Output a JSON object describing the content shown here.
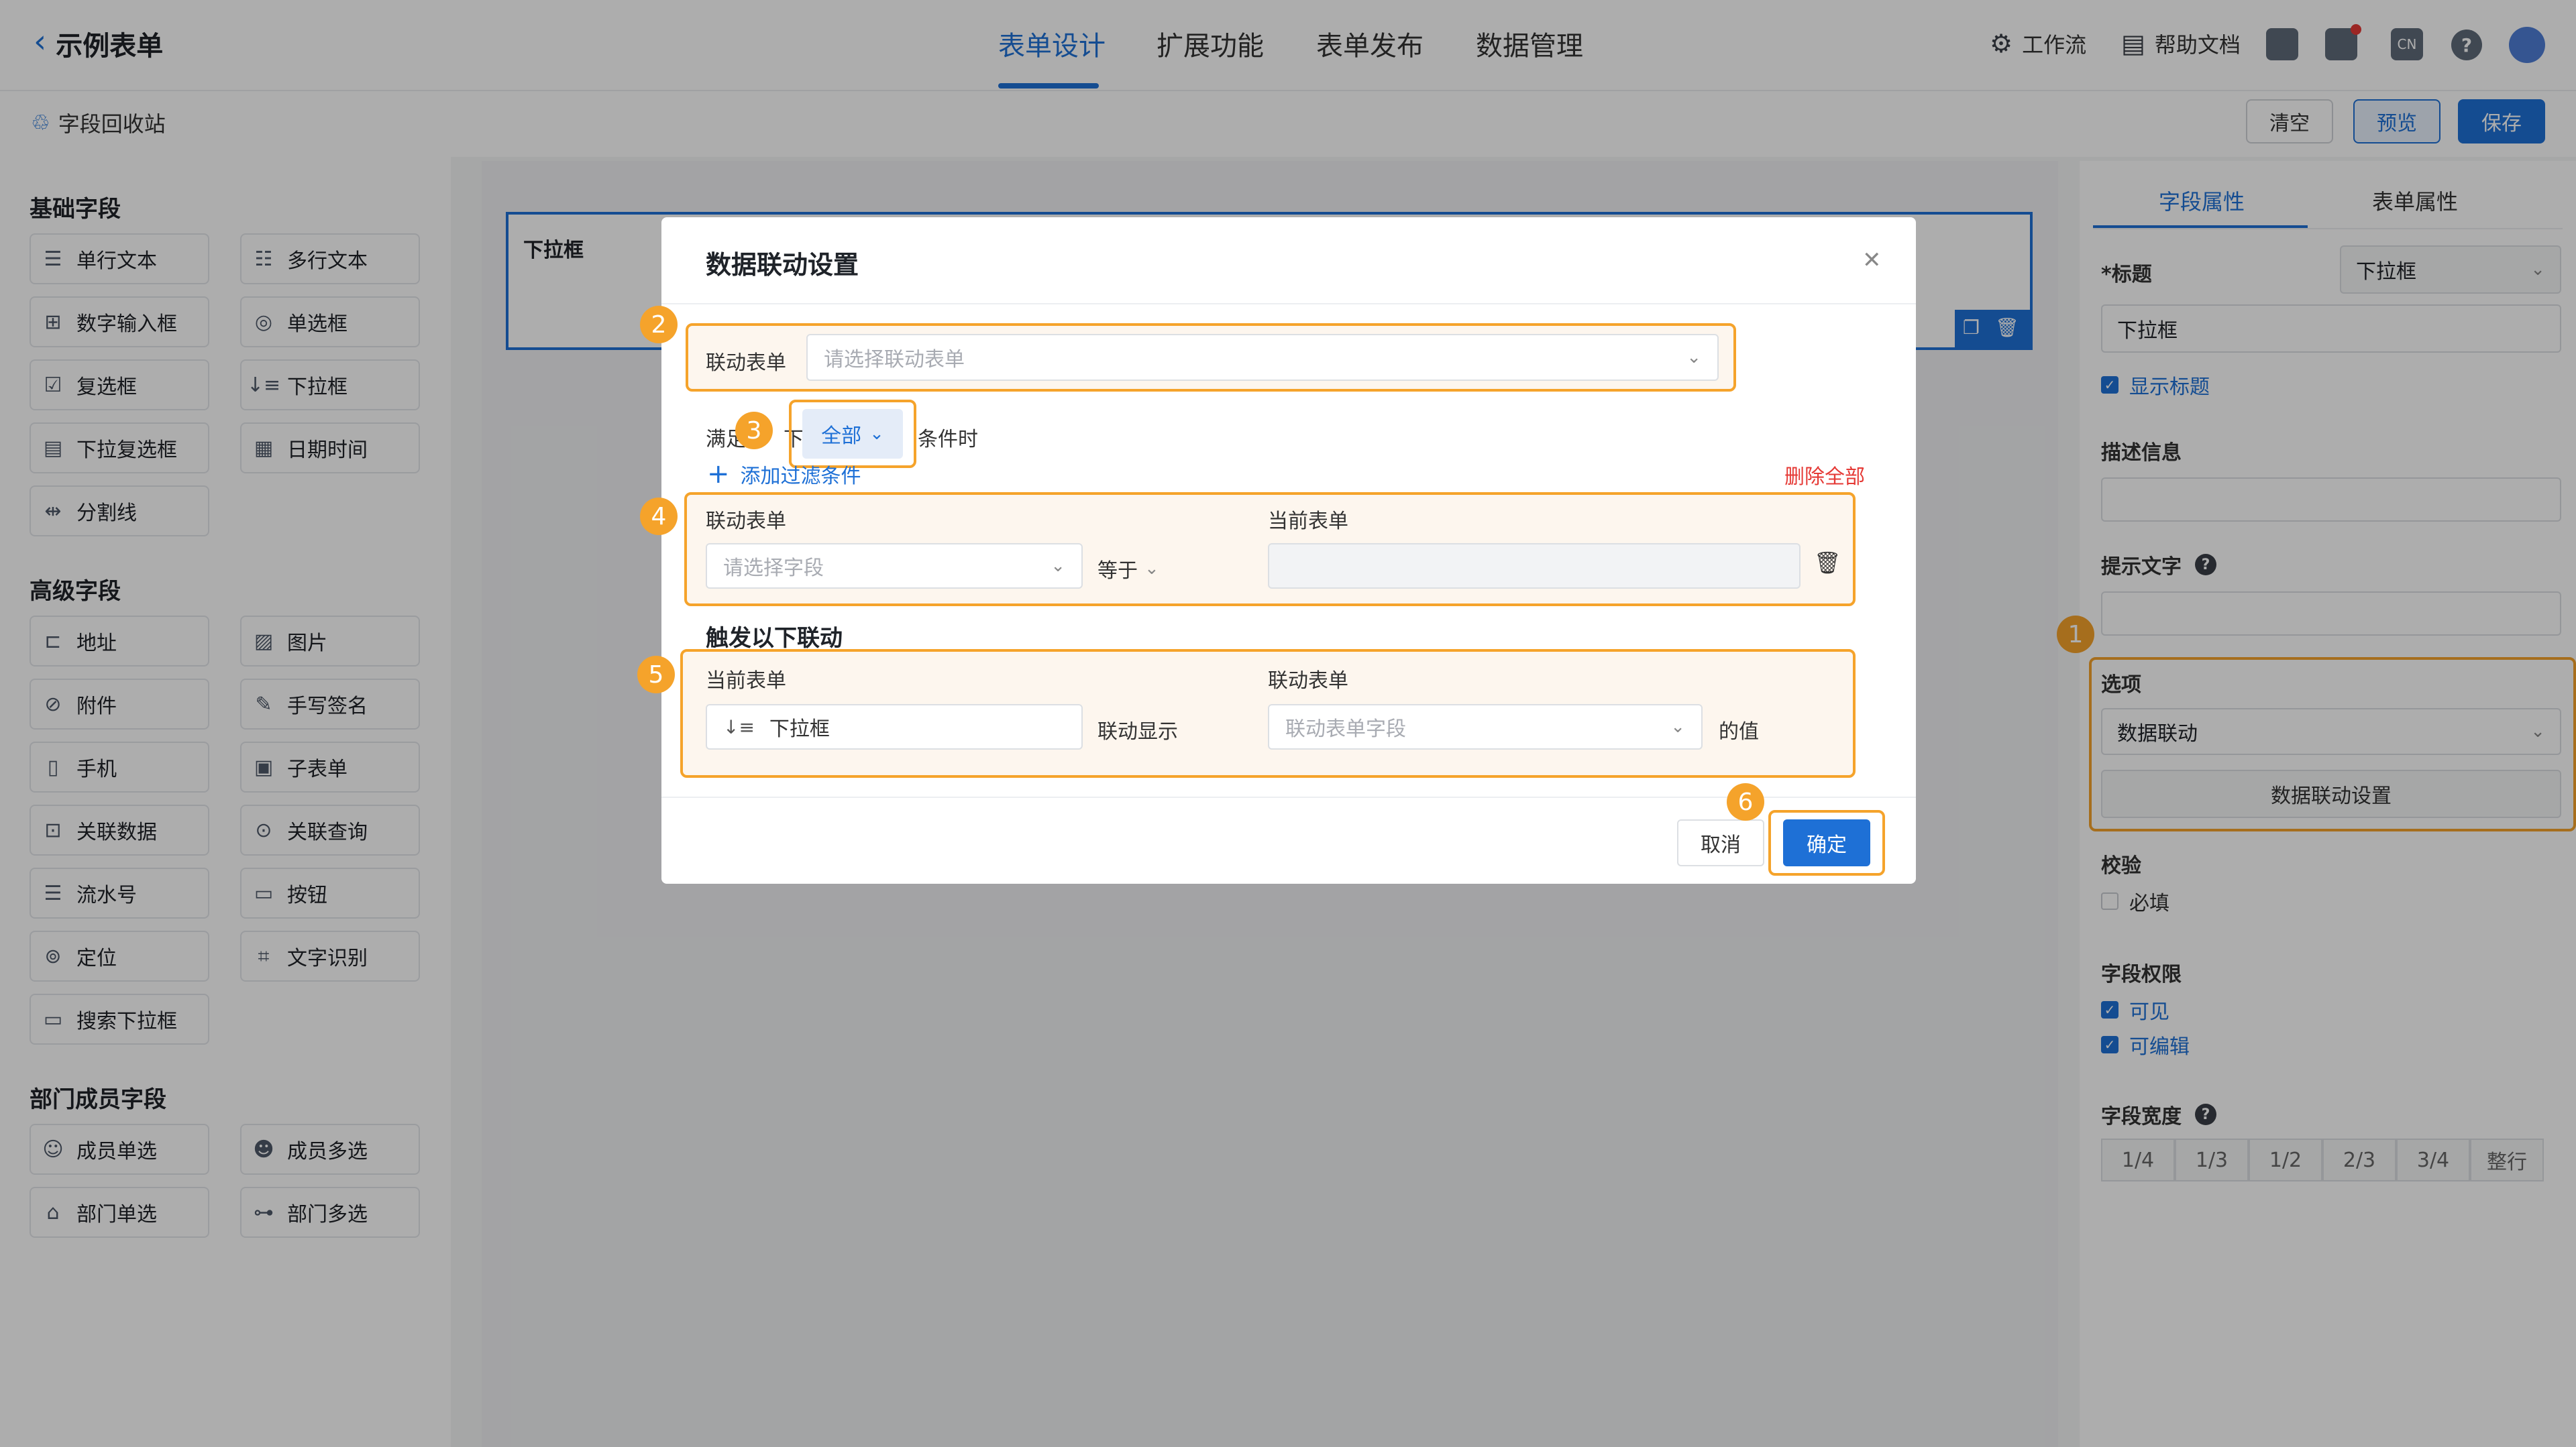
{
  "header": {
    "back_label": "示例表单",
    "tabs": [
      "表单设计",
      "扩展功能",
      "表单发布",
      "数据管理"
    ],
    "active_tab": 0,
    "workflow": "工作流",
    "help": "帮助文档",
    "lang": "CN"
  },
  "toolbar": {
    "recycle": "字段回收站",
    "clear": "清空",
    "preview": "预览",
    "save": "保存"
  },
  "fields": {
    "basic_title": "基础字段",
    "basic": [
      "单行文本",
      "多行文本",
      "数字输入框",
      "单选框",
      "复选框",
      "下拉框",
      "下拉复选框",
      "日期时间",
      "分割线"
    ],
    "advanced_title": "高级字段",
    "advanced": [
      "地址",
      "图片",
      "附件",
      "手写签名",
      "手机",
      "子表单",
      "关联数据",
      "关联查询",
      "流水号",
      "按钮",
      "定位",
      "文字识别",
      "搜索下拉框"
    ],
    "dept_title": "部门成员字段",
    "dept": [
      "成员单选",
      "成员多选",
      "部门单选",
      "部门多选"
    ]
  },
  "canvas": {
    "card_label": "下拉框"
  },
  "props": {
    "tab_field": "字段属性",
    "tab_form": "表单属性",
    "title_label": "*标题",
    "title_type": "下拉框",
    "title_value": "下拉框",
    "show_title": "显示标题",
    "desc_label": "描述信息",
    "hint_label": "提示文字",
    "options_label": "选项",
    "options_value": "数据联动",
    "options_button": "数据联动设置",
    "validate_label": "校验",
    "required": "必填",
    "perm_label": "字段权限",
    "visible": "可见",
    "editable": "可编辑",
    "width_label": "字段宽度",
    "widths": [
      "1/4",
      "1/3",
      "1/2",
      "2/3",
      "3/4",
      "整行"
    ]
  },
  "modal": {
    "title": "数据联动设置",
    "linked_form_label": "联动表单",
    "linked_form_placeholder": "请选择联动表单",
    "meet_prefix": "满足",
    "meet_mid": "下",
    "meet_suffix": "条件时",
    "all": "全部",
    "add_filter": "添加过滤条件",
    "delete_all": "删除全部",
    "cond_left_label": "联动表单",
    "cond_right_label": "当前表单",
    "cond_field_placeholder": "请选择字段",
    "cond_op": "等于",
    "trigger_title": "触发以下联动",
    "trig_left_label": "当前表单",
    "trig_right_label": "联动表单",
    "trig_field": "下拉框",
    "trig_show": "联动显示",
    "trig_placeholder": "联动表单字段",
    "trig_suffix": "的值",
    "cancel": "取消",
    "ok": "确定"
  },
  "badges": [
    "1",
    "2",
    "3",
    "4",
    "5",
    "6"
  ]
}
